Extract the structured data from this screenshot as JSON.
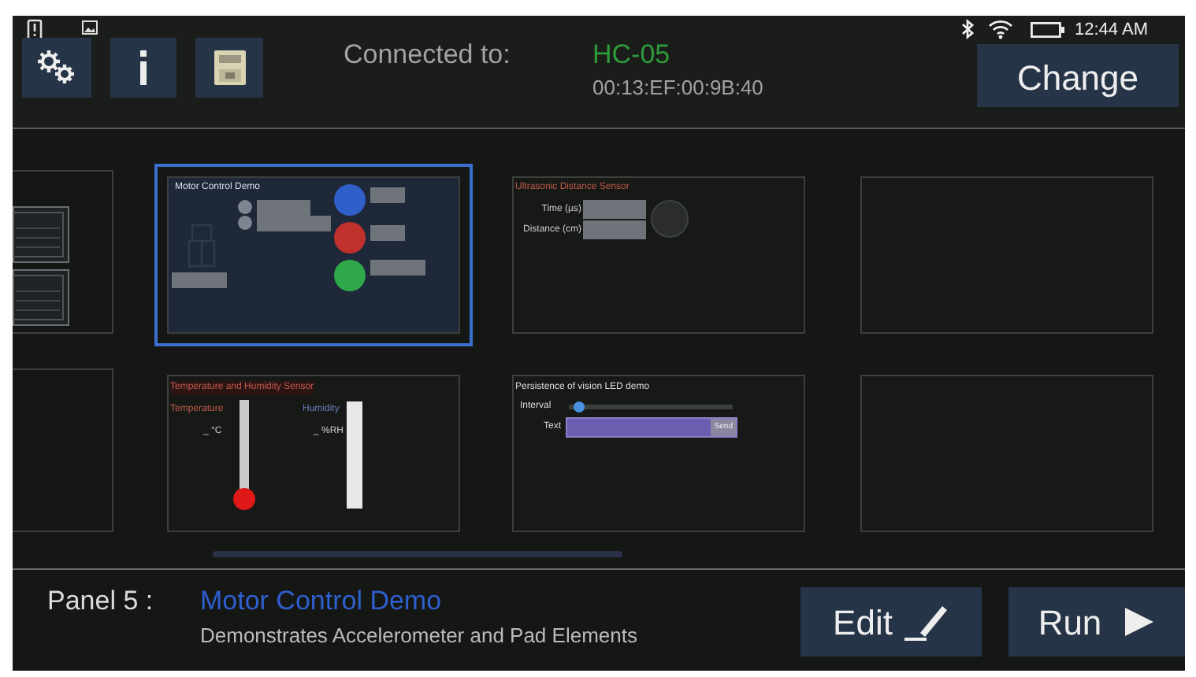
{
  "status_bar": {
    "time": "12:44 AM"
  },
  "toolbar": {
    "connected_label": "Connected to:",
    "device_name": "HC-05",
    "device_address": "00:13:EF:00:9B:40",
    "change_button": "Change"
  },
  "panel_rows": [
    {
      "panels": [
        {
          "kind": "partial",
          "selected": false,
          "widgets": [
            {
              "kind": "graph"
            },
            {
              "kind": "graph"
            }
          ]
        },
        {
          "kind": "motor",
          "selected": true,
          "title": "Motor Control Demo",
          "leds": [
            {
              "color": "#2f5fc8"
            },
            {
              "color": "#c0302c"
            },
            {
              "color": "#2fa84a"
            }
          ]
        },
        {
          "kind": "ultrasonic",
          "selected": false,
          "title": "Ultrasonic Distance Sensor",
          "rows": [
            {
              "label": "Time (µs)"
            },
            {
              "label": "Distance (cm)"
            }
          ]
        },
        {
          "kind": "empty",
          "selected": false
        }
      ]
    },
    {
      "panels": [
        {
          "kind": "partial",
          "selected": false
        },
        {
          "kind": "temperature",
          "selected": false,
          "title": "Temperature and Humidity Sensor",
          "temperature_label": "Temperature",
          "temperature_reading": "_ °C",
          "humidity_label": "Humidity",
          "humidity_reading": "_ %RH"
        },
        {
          "kind": "pov",
          "selected": false,
          "title": "Persistence of vision LED demo",
          "interval": {
            "label": "Interval",
            "level": 0.03
          },
          "text_label": "Text",
          "send_button": "Send"
        },
        {
          "kind": "empty",
          "selected": false
        }
      ]
    }
  ],
  "footer": {
    "panel_label": "Panel 5 :",
    "panel_name": "Motor Control Demo",
    "description": "Demonstrates Accelerometer and Pad Elements",
    "edit_button": "Edit",
    "run_button": "Run"
  }
}
